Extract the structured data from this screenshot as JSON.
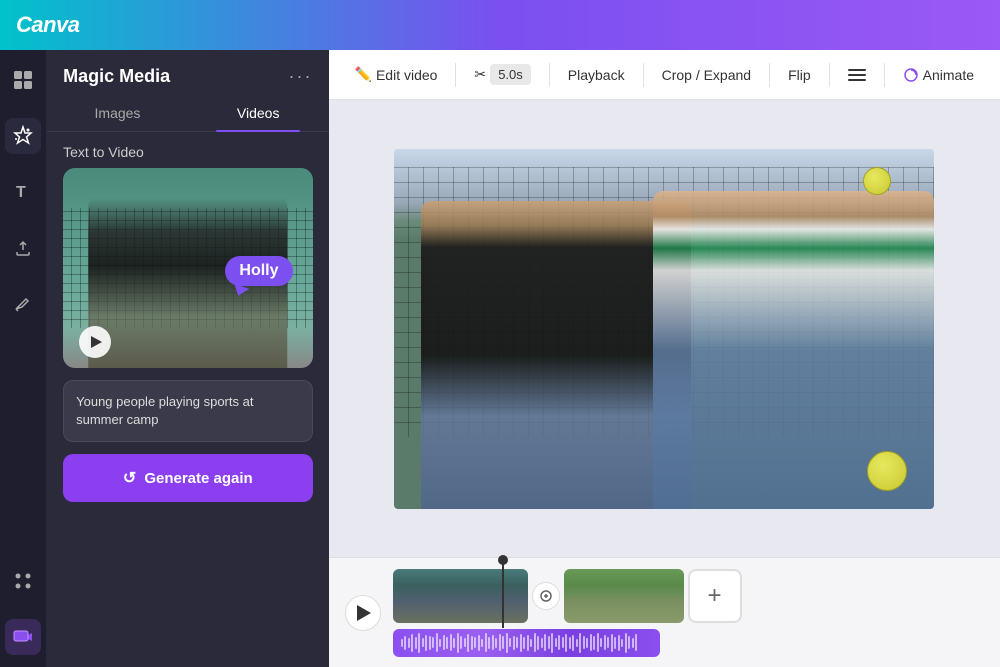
{
  "header": {
    "logo": "Canva"
  },
  "left_panel": {
    "title": "Magic Media",
    "menu_label": "···",
    "tabs": [
      {
        "label": "Images",
        "active": false
      },
      {
        "label": "Videos",
        "active": true
      }
    ],
    "section_label": "Text to Video",
    "prompt_text": "Young people playing sports at summer camp",
    "generate_btn_label": "Generate again",
    "holly_badge": "Holly"
  },
  "toolbar": {
    "edit_video_label": "Edit video",
    "duration_label": "5.0s",
    "playback_label": "Playback",
    "crop_expand_label": "Crop / Expand",
    "flip_label": "Flip",
    "animate_label": "Animate"
  },
  "timeline": {
    "play_label": "▶",
    "add_clip_label": "+"
  },
  "waveform_heights": [
    8,
    14,
    10,
    18,
    12,
    20,
    9,
    16,
    14,
    11,
    19,
    8,
    15,
    12,
    17,
    10,
    20,
    13,
    9,
    18,
    14,
    11,
    16,
    8,
    19,
    12,
    15,
    10,
    17,
    13,
    20,
    9,
    14,
    11,
    18,
    12,
    16,
    8,
    19,
    14,
    10,
    17,
    13,
    20,
    9,
    15,
    11,
    18,
    12,
    16,
    8,
    20,
    13,
    10,
    17,
    14,
    19,
    9,
    15,
    11,
    18,
    12,
    16,
    8,
    20,
    13,
    10,
    17
  ]
}
